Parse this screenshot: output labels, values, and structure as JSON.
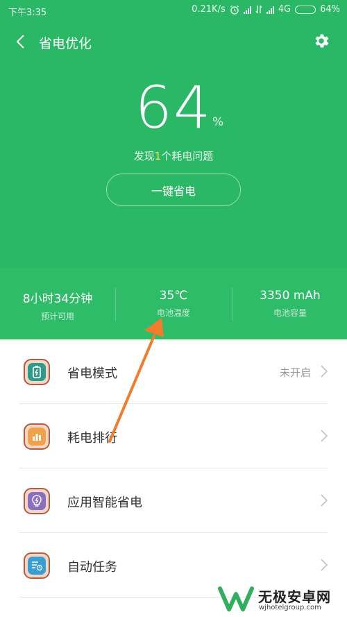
{
  "status_bar": {
    "time": "下午3:35",
    "speed": "0.21K/s",
    "network": "4G",
    "battery": "64%",
    "battery_level": 0.64
  },
  "header": {
    "title": "省电优化",
    "back_icon": "chevron-left-icon",
    "settings_icon": "gear-icon"
  },
  "battery": {
    "percent": "64",
    "unit": "%"
  },
  "issue": {
    "prefix": "发现",
    "count": "1",
    "suffix": "个耗电问题"
  },
  "one_key_label": "一键省电",
  "stats": [
    {
      "value": "8小时34分钟",
      "label": "预计可用"
    },
    {
      "value": "35℃",
      "label": "电池温度"
    },
    {
      "value": "3350 mAh",
      "label": "电池容量"
    }
  ],
  "menu": [
    {
      "label": "省电模式",
      "value": "未开启",
      "icon": "battery-icon"
    },
    {
      "label": "耗电排行",
      "value": "",
      "icon": "bar-chart-icon"
    },
    {
      "label": "应用智能省电",
      "value": "",
      "icon": "lightbulb-icon"
    },
    {
      "label": "自动任务",
      "value": "",
      "icon": "task-list-icon"
    }
  ],
  "watermark": {
    "name": "无极安卓网",
    "url": "wjhotelgroup.com"
  },
  "colors": {
    "header_green": "#2bb866",
    "highlight_yellow": "#ffe55c",
    "arrow_orange": "#f07c2c"
  }
}
